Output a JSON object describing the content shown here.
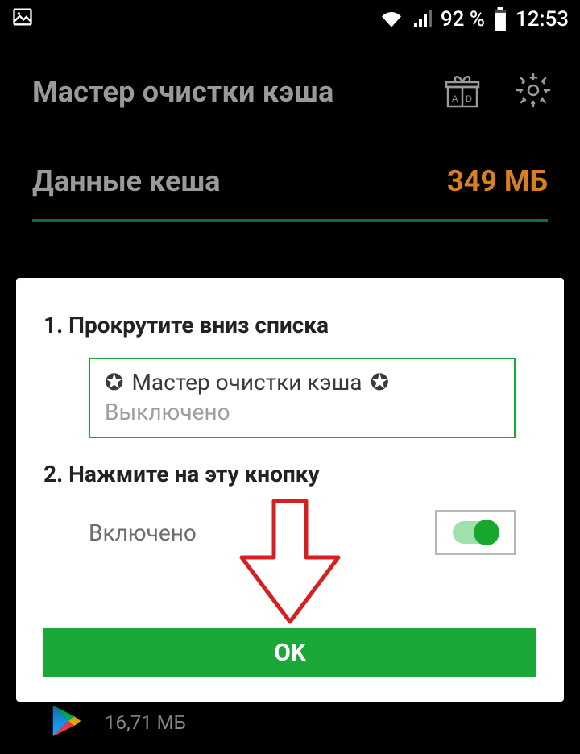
{
  "status": {
    "battery_text": "92 %",
    "time": "12:53"
  },
  "header": {
    "title": "Мастер очистки кэша"
  },
  "cache": {
    "label": "Данные кеша",
    "value": "349 МБ"
  },
  "dialog": {
    "step1_title": "1. Прокрутите вниз списка",
    "list_item_name": "Мастер очистки кэша",
    "list_item_status": "Выключено",
    "step2_title": "2. Нажмите на эту кнопку",
    "enabled_label": "Включено",
    "ok_label": "OK"
  },
  "bg_item": {
    "size": "16,71 МБ"
  },
  "icons": {
    "star": "✪"
  }
}
